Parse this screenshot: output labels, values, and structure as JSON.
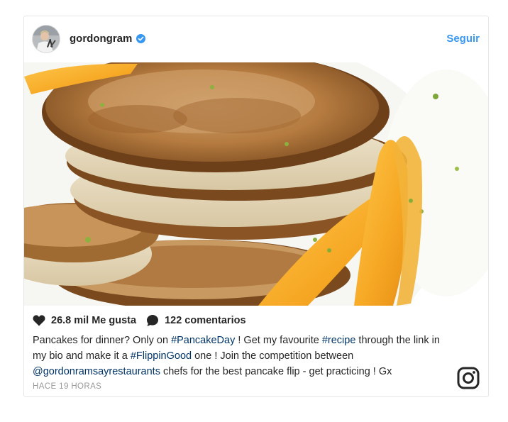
{
  "post": {
    "username": "gordongram",
    "follow_label": "Seguir",
    "likes": "26.8 mil Me gusta",
    "comments": "122 comentarios",
    "caption": {
      "t1": "Pancakes for dinner? Only on ",
      "tag1": "#PancakeDay",
      "t2": " ! Get my favourite ",
      "tag2": "#recipe",
      "t3": " through the link in my bio and make it a ",
      "tag3": "#FlippinGood",
      "t4": " one ! Join the competition between ",
      "mention": "@gordonramsayrestaurants",
      "t5": " chefs for the best pancake flip - get practicing ! Gx"
    },
    "timestamp": "HACE 19 HORAS"
  },
  "icons": {
    "verified": "verified-badge-icon",
    "like": "heart-icon",
    "comment": "comment-bubble-icon",
    "brand": "instagram-logo-icon"
  },
  "colors": {
    "link": "#3897f0",
    "hashtag": "#003569",
    "muted": "#999999",
    "text": "#262626"
  }
}
